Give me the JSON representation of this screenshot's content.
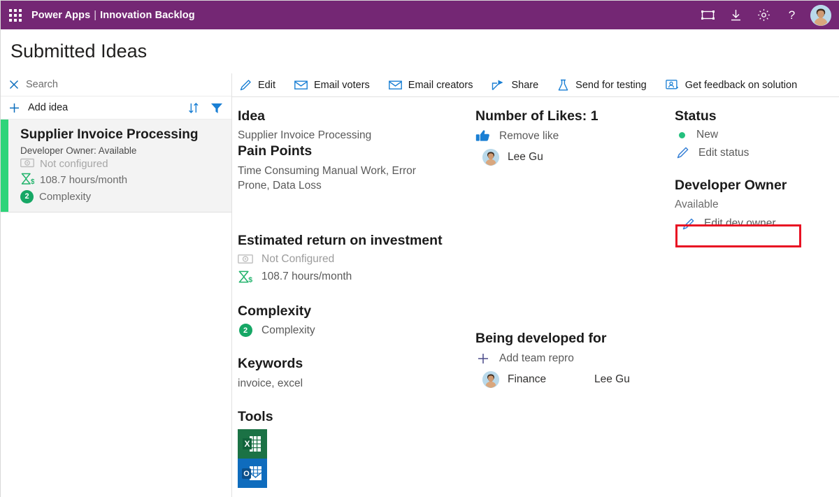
{
  "colors": {
    "brand_purple": "#742774",
    "accent_blue": "#0b6ebd",
    "accent_green": "#2ed47a",
    "badge_green": "#16a765",
    "highlight_red": "#e81123"
  },
  "topbar": {
    "waffle_icon": "waffle-grid-icon",
    "product": "Power Apps",
    "separator": "|",
    "app_name": "Innovation Backlog",
    "icons": [
      {
        "name": "fit-to-screen-icon",
        "label": "Fit to screen"
      },
      {
        "name": "download-icon",
        "label": "Download"
      },
      {
        "name": "gear-icon",
        "label": "Settings"
      },
      {
        "name": "help-icon",
        "label": "Help"
      }
    ],
    "avatar": "user-avatar"
  },
  "page": {
    "title": "Submitted Ideas"
  },
  "sidebar": {
    "search": {
      "placeholder": "Search",
      "clear_icon": "close-icon"
    },
    "add": {
      "label": "Add idea",
      "plus_icon": "plus-icon"
    },
    "tools": [
      {
        "name": "sort-icon",
        "label": "Sort"
      },
      {
        "name": "filter-icon",
        "label": "Filter"
      }
    ],
    "items": [
      {
        "title": "Supplier Invoice Processing",
        "subtitle": "Developer Owner: Available",
        "roi_money": "Not configured",
        "roi_money_icon": "money-icon",
        "roi_time": "108.7 hours/month",
        "roi_time_icon": "hourglass-dollar-icon",
        "complexity_value": "2",
        "complexity_label": "Complexity",
        "selected": true
      }
    ]
  },
  "commandbar": {
    "items": [
      {
        "label": "Edit",
        "icon": "pencil-icon"
      },
      {
        "label": "Email voters",
        "icon": "envelope-icon"
      },
      {
        "label": "Email creators",
        "icon": "envelope-icon"
      },
      {
        "label": "Share",
        "icon": "share-icon"
      },
      {
        "label": "Send for testing",
        "icon": "flask-icon"
      },
      {
        "label": "Get feedback on solution",
        "icon": "feedback-person-icon"
      }
    ]
  },
  "detail": {
    "idea": {
      "heading": "Idea",
      "value": "Supplier Invoice Processing"
    },
    "pain_points": {
      "heading": "Pain Points",
      "value": "Time Consuming Manual Work, Error Prone, Data Loss"
    },
    "roi": {
      "heading": "Estimated return on investment",
      "money_label": "Not Configured",
      "money_icon": "money-icon",
      "time_label": "108.7 hours/month",
      "time_icon": "hourglass-dollar-icon"
    },
    "complexity": {
      "heading": "Complexity",
      "value": "2",
      "label": "Complexity"
    },
    "keywords": {
      "heading": "Keywords",
      "value": "invoice, excel"
    },
    "tools": {
      "heading": "Tools",
      "items": [
        {
          "name": "excel-icon",
          "label": "Excel",
          "color": "#1b7245"
        },
        {
          "name": "outlook-icon",
          "label": "Outlook",
          "color": "#0f6cbd"
        }
      ]
    },
    "likes": {
      "heading": "Number of Likes: 1",
      "action_label": "Remove like",
      "action_icon": "thumbs-up-icon",
      "voters": [
        {
          "name": "Lee Gu",
          "avatar": "user-avatar"
        }
      ]
    },
    "developed_for": {
      "heading": "Being developed for",
      "add_label": "Add team repro",
      "add_icon": "plus-icon",
      "rows": [
        {
          "team": "Finance",
          "person": "Lee Gu",
          "avatar": "user-avatar"
        }
      ]
    },
    "status": {
      "heading": "Status",
      "value": "New",
      "dot_icon": "status-dot-icon",
      "edit_label": "Edit status",
      "edit_icon": "pencil-icon"
    },
    "developer_owner": {
      "heading": "Developer Owner",
      "value": "Available",
      "edit_label": "Edit dev owner",
      "edit_icon": "pencil-icon",
      "highlighted": true
    }
  }
}
